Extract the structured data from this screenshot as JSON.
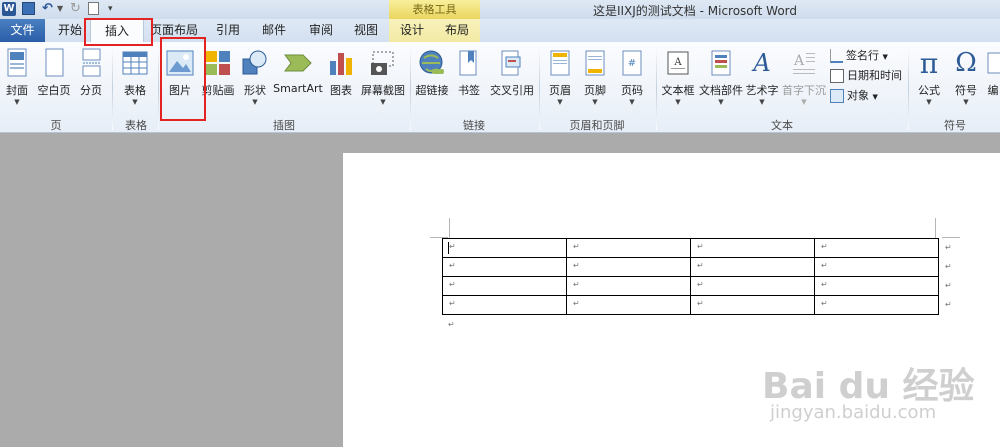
{
  "titlebar": {
    "title": "这是IIXJ的测试文档 - Microsoft Word",
    "context_header": "表格工具",
    "word_logo": "W"
  },
  "tabs": [
    {
      "label": "文件"
    },
    {
      "label": "开始"
    },
    {
      "label": "插入"
    },
    {
      "label": "页面布局"
    },
    {
      "label": "引用"
    },
    {
      "label": "邮件"
    },
    {
      "label": "审阅"
    },
    {
      "label": "视图"
    },
    {
      "label": "设计"
    },
    {
      "label": "布局"
    }
  ],
  "ribbon": {
    "pages": {
      "cover": "封面",
      "blank": "空白页",
      "break": "分页",
      "group": "页"
    },
    "tables": {
      "table": "表格",
      "group": "表格"
    },
    "illustrations": {
      "picture": "图片",
      "clipart": "剪贴画",
      "shapes": "形状",
      "smartart": "SmartArt",
      "chart": "图表",
      "screenshot": "屏幕截图",
      "group": "插图"
    },
    "links": {
      "hyperlink": "超链接",
      "bookmark": "书签",
      "crossref": "交叉引用",
      "group": "链接"
    },
    "header_footer": {
      "header": "页眉",
      "footer": "页脚",
      "pagenum": "页码",
      "group": "页眉和页脚"
    },
    "text": {
      "textbox": "文本框",
      "quickparts": "文档部件",
      "wordart": "艺术字",
      "dropcap": "首字下沉",
      "signature": "签名行",
      "datetime": "日期和时间",
      "object": "对象",
      "group": "文本"
    },
    "symbols": {
      "equation": "公式",
      "symbol": "符号",
      "number": "编",
      "group": "符号",
      "pi": "π",
      "omega": "Ω"
    }
  },
  "document": {
    "paragraph_mark": "↵",
    "table": {
      "rows": 4,
      "cols": 4
    }
  },
  "watermark": {
    "brand": "Bai du 经验",
    "url": "jingyan.baidu.com"
  },
  "colors": {
    "file_tab": "#2b5ea8",
    "highlight": "#e32222",
    "context_tab": "#f2e9a3"
  }
}
